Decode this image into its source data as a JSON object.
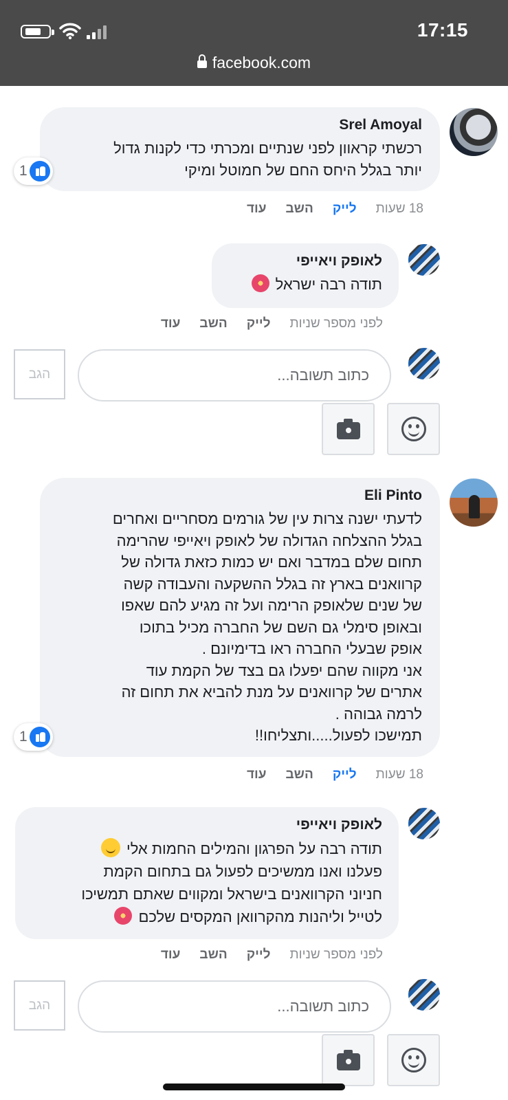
{
  "status_bar": {
    "time": "17:15",
    "url": "facebook.com"
  },
  "comments": [
    {
      "author": "Srel Amoyal",
      "text_lines": [
        "רכשתי קראוון לפני שנתיים ומכרתי כדי לקנות גדול",
        "יותר בגלל היחס החם של חמוטל ומיקי"
      ],
      "likes": "1",
      "time": "18 שעות",
      "like_label": "לייק",
      "reply_label": "השב",
      "more_label": "עוד"
    },
    {
      "author": "Eli Pinto",
      "text_lines": [
        "לדעתי ישנה צרות עין של גורמים מסחריים ואחרים",
        "בגלל ההצלחה הגדולה של לאופק ויאייפי שהרימה",
        "תחום שלם במדבר ואם יש כמות כזאת גדולה של",
        "קרוואנים בארץ זה בגלל ההשקעה והעבודה קשה",
        "של שנים שלאופק הרימה ועל זה מגיע להם שאפו",
        "ובאופן סימלי גם השם של החברה מכיל בתוכו",
        "אופק שבעלי החברה ראו בדימיונם .",
        "אני מקווה שהם יפעלו גם בצד של הקמת עוד",
        "אתרים של קרוואנים על מנת להביא את תחום זה",
        "לרמה גבוהה .",
        "תמישכו לפעול.....ותצליחו!!"
      ],
      "likes": "1",
      "time": "18 שעות",
      "like_label": "לייק",
      "reply_label": "השב",
      "more_label": "עוד"
    }
  ],
  "replies": [
    {
      "author": "לאופק ויאייפי",
      "text": "תודה רבה ישראל",
      "time": "לפני מספר שניות",
      "like_label": "לייק",
      "reply_label": "השב",
      "more_label": "עוד"
    },
    {
      "author": "לאופק ויאייפי",
      "text_lines": [
        "תודה רבה על הפרגון והמילים החמות אלי",
        "פעלנו ואנו ממשיכים לפעול גם בתחום הקמת",
        "חניוני הקרוואנים בישראל ומקווים שאתם תמשיכו",
        "לטייל וליהנות מהקרוואן המקסים שלכם"
      ],
      "time": "לפני מספר שניות",
      "like_label": "לייק",
      "reply_label": "השב",
      "more_label": "עוד"
    }
  ],
  "composer": {
    "placeholder": "כתוב תשובה...",
    "post_label": "הגב"
  },
  "icons": {
    "like": "thumbs-up-icon",
    "emoji": "smile-icon",
    "camera": "camera-icon",
    "lock": "lock-icon"
  },
  "colors": {
    "accent": "#1877f2",
    "bubble": "#f0f2f5",
    "statusbar": "#4a4a4a"
  }
}
